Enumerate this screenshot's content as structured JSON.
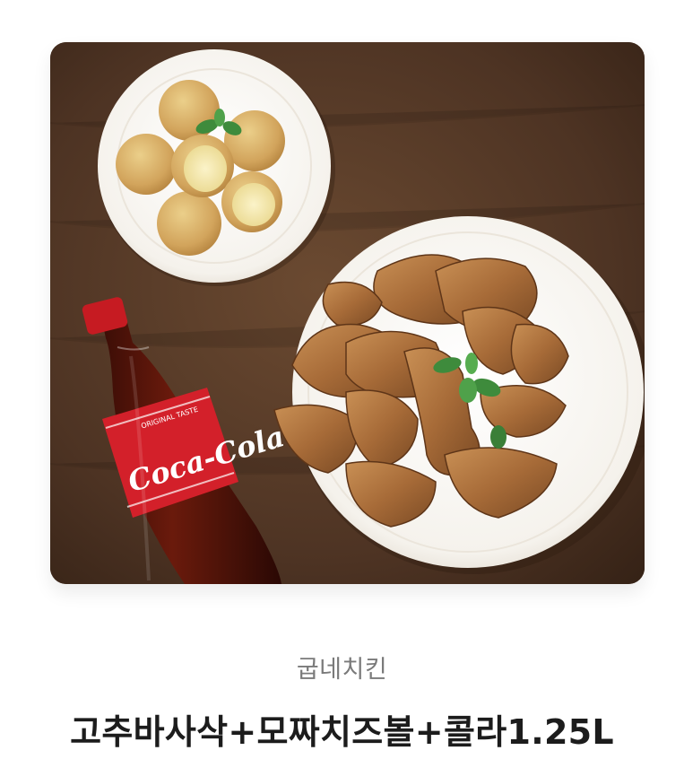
{
  "product": {
    "brand": "굽네치킨",
    "name": "고추바사삭+모짜치즈볼+콜라1.25L",
    "image": {
      "subject": "chicken-cheeseball-cola-set",
      "bottle_label": "Coca-Cola",
      "bottle_small_text": "ORIGINAL TASTE",
      "colors": {
        "table": "#4a3222",
        "plate": "#f6f3ee",
        "chicken": "#b57a44",
        "cheeseball": "#d9b46b",
        "cheese_fill": "#f3e6a5",
        "cola_red": "#d3202a",
        "mint": "#3e8b3c"
      }
    }
  }
}
